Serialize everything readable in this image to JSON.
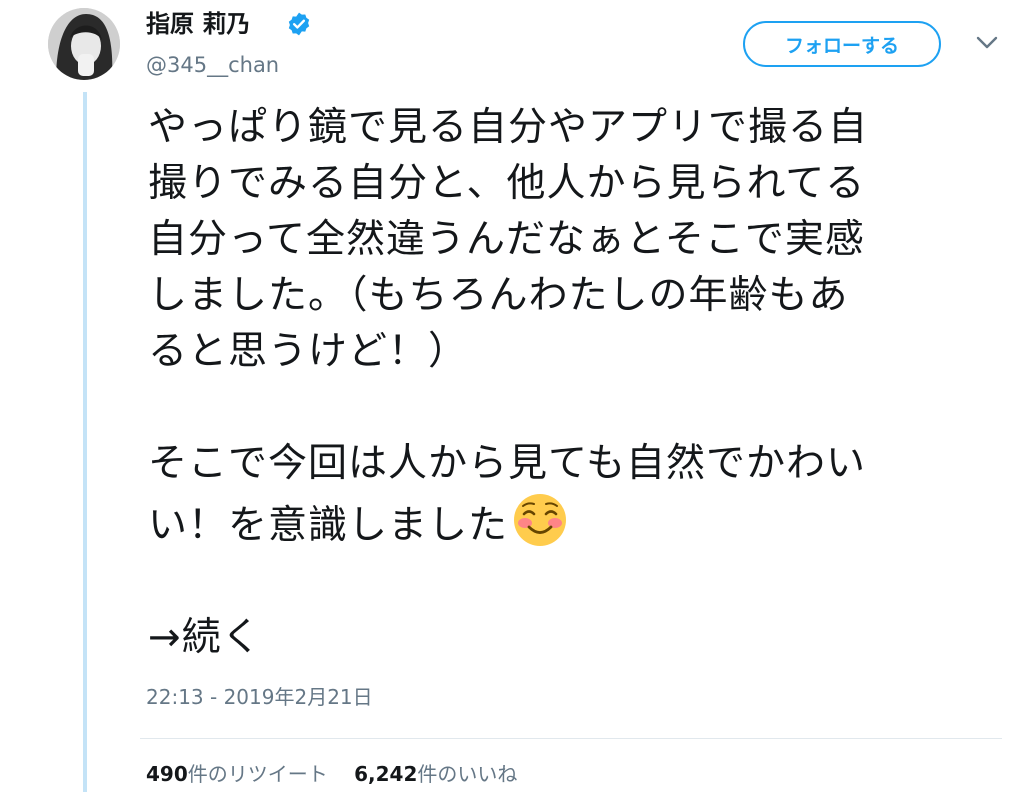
{
  "user": {
    "display_name": "指原 莉乃",
    "handle": "@345__chan",
    "verified": true
  },
  "follow_button": {
    "label": "フォローする"
  },
  "tweet": {
    "lines": [
      "やっぱり鏡で見る自分やアプリで撮る自",
      "撮りでみる自分と、他人から見られてる",
      "自分って全然違うんだなぁとそこで実感",
      "しました。（もちろんわたしの年齢もあ",
      "ると思うけど！）",
      "そこで今回は人から見ても自然でかわい",
      "い！を意識しました",
      "→続く"
    ],
    "emoji": "smiling-face-with-blush"
  },
  "timestamp": "22:13 - 2019年2月21日",
  "stats": {
    "retweets_count": "490",
    "retweets_label": "件のリツイート",
    "likes_count": "6,242",
    "likes_label": "件のいいね"
  },
  "colors": {
    "accent": "#1da1f2",
    "thread_line": "#c4e3f7",
    "secondary_text": "#657786"
  }
}
